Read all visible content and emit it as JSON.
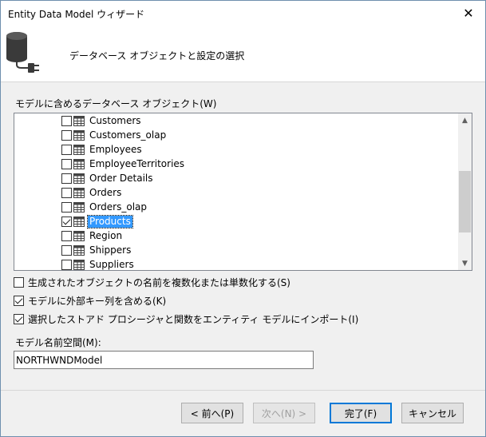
{
  "window": {
    "title": "Entity Data Model ウィザード",
    "close_glyph": "✕"
  },
  "header": {
    "title": "データベース オブジェクトと設定の選択",
    "icon": "database-plug-icon"
  },
  "objects_section": {
    "label": "モデルに含めるデータベース オブジェクト(W)",
    "items": [
      {
        "label": "Customers",
        "checked": false,
        "selected": false
      },
      {
        "label": "Customers_olap",
        "checked": false,
        "selected": false
      },
      {
        "label": "Employees",
        "checked": false,
        "selected": false
      },
      {
        "label": "EmployeeTerritories",
        "checked": false,
        "selected": false
      },
      {
        "label": "Order Details",
        "checked": false,
        "selected": false
      },
      {
        "label": "Orders",
        "checked": false,
        "selected": false
      },
      {
        "label": "Orders_olap",
        "checked": false,
        "selected": false
      },
      {
        "label": "Products",
        "checked": true,
        "selected": true
      },
      {
        "label": "Region",
        "checked": false,
        "selected": false
      },
      {
        "label": "Shippers",
        "checked": false,
        "selected": false
      },
      {
        "label": "Suppliers",
        "checked": false,
        "selected": false
      }
    ],
    "scroll_up_glyph": "▲",
    "scroll_down_glyph": "▼"
  },
  "options": {
    "pluralize": {
      "label": "生成されたオブジェクトの名前を複数化または単数化する(S)",
      "checked": false
    },
    "foreign_keys": {
      "label": "モデルに外部キー列を含める(K)",
      "checked": true
    },
    "import_procs": {
      "label": "選択したストアド プロシージャと関数をエンティティ モデルにインポート(I)",
      "checked": true
    }
  },
  "namespace": {
    "label": "モデル名前空間(M):",
    "value": "NORTHWNDModel"
  },
  "buttons": {
    "prev": "< 前へ(P)",
    "next": "次へ(N) >",
    "finish": "完了(F)",
    "cancel": "キャンセル"
  },
  "colors": {
    "selection": "#3399ff",
    "default_button_border": "#0078d7"
  }
}
